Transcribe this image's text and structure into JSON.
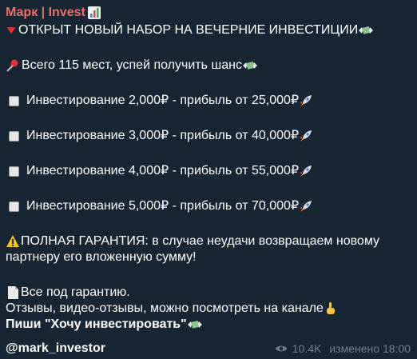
{
  "channel": {
    "name": "Марк | Invest",
    "handle": "@mark_investor"
  },
  "post": {
    "headline": "ОТКРЫТ НОВЫЙ НАБОР НА ВЕЧЕРНИЕ ИНВЕСТИЦИИ",
    "seats": "Всего 115 мест, успей получить шанс",
    "offers": [
      "Инвестирование 2,000₽ -  прибыль от 25,000₽",
      "Инвестирование 3,000₽ -  прибыль от 40,000₽",
      "Инвестирование 4,000₽ -  прибыль от 55,000₽",
      "Инвестирование 5,000₽ -  прибыль от 70,000₽"
    ],
    "guarantee_line1": "ПОЛНАЯ ГАРАНТИЯ: в случае неудачи возвращаем новому",
    "guarantee_line2": "партнеру его вложенную сумму!",
    "all_guaranteed": "Все под гарантию.",
    "reviews": "Отзывы, видео-отзывы, можно посмотреть на канале",
    "cta": "Пиши \"Хочу инвестировать\""
  },
  "meta": {
    "views": "10.4K",
    "edited": "изменено 18:00"
  },
  "icons": {
    "chart": "chart-increasing-icon",
    "triangle": "red-triangle-down-icon",
    "money": "money-with-wings-icon",
    "pin": "pushpin-icon",
    "rocket": "rocket-icon",
    "warning": "warning-icon",
    "page": "page-icon",
    "finger": "index-pointing-up-icon",
    "eye": "eye-icon"
  },
  "colors": {
    "background": "#182533",
    "channel_name": "#e8706a",
    "meta": "#6d7f8f"
  }
}
